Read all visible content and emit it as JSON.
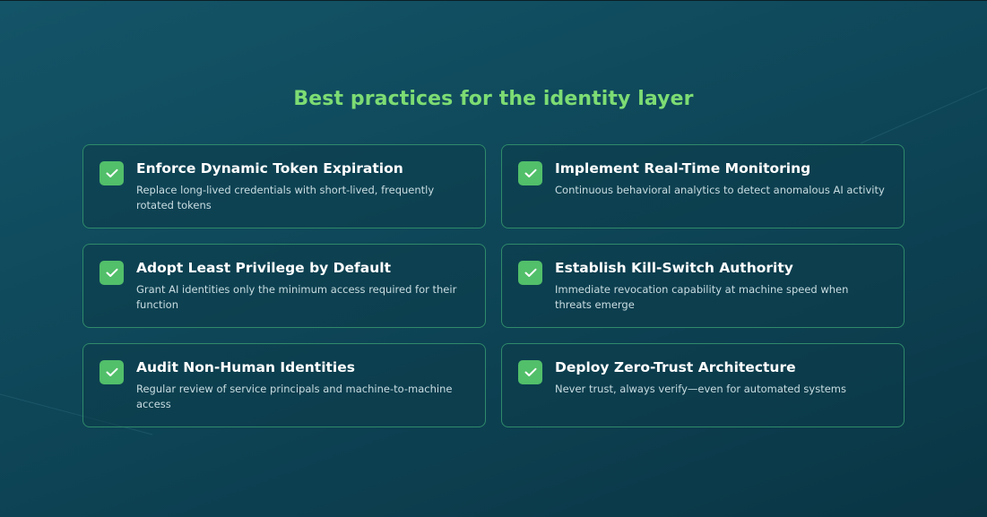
{
  "title": "Best practices for the identity layer",
  "colors": {
    "accent": "#7ddc73",
    "check_fill": "#52bf6a",
    "card_border": "#2f8a6a",
    "background": "#0f4a5c"
  },
  "practices": [
    {
      "title": "Enforce Dynamic Token Expiration",
      "description": "Replace long-lived credentials with short-lived, frequently rotated tokens",
      "icon": "checkmark-icon"
    },
    {
      "title": "Implement Real-Time Monitoring",
      "description": "Continuous behavioral analytics to detect anomalous AI activity",
      "icon": "checkmark-icon"
    },
    {
      "title": "Adopt Least Privilege by Default",
      "description": "Grant AI identities only the minimum access required for their function",
      "icon": "checkmark-icon"
    },
    {
      "title": "Establish Kill-Switch Authority",
      "description": "Immediate revocation capability at machine speed when threats emerge",
      "icon": "checkmark-icon"
    },
    {
      "title": "Audit Non-Human Identities",
      "description": "Regular review of service principals and machine-to-machine access",
      "icon": "checkmark-icon"
    },
    {
      "title": "Deploy Zero-Trust Architecture",
      "description": "Never trust, always verify—even for automated systems",
      "icon": "checkmark-icon"
    }
  ]
}
